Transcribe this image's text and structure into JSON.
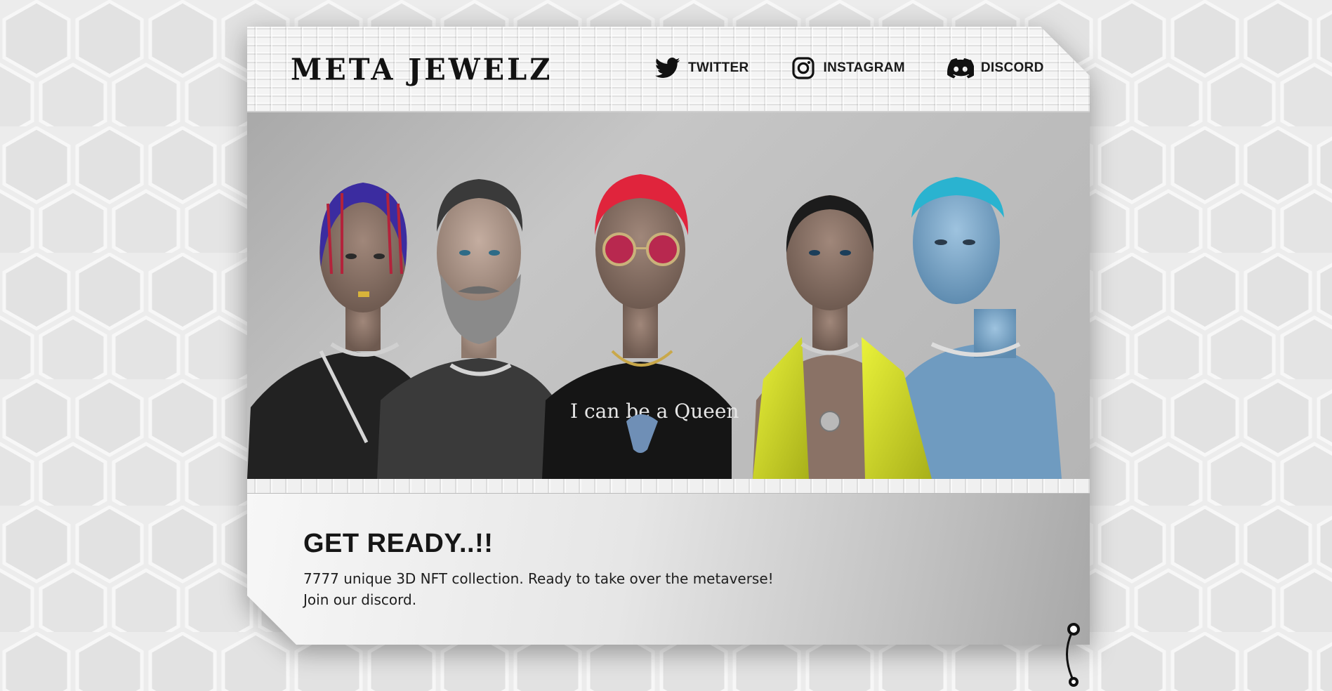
{
  "brand": {
    "logo_text": "META JEWELZ"
  },
  "nav": {
    "items": [
      {
        "label": "TWITTER",
        "icon": "twitter-icon"
      },
      {
        "label": "INSTAGRAM",
        "icon": "instagram-icon"
      },
      {
        "label": "DISCORD",
        "icon": "discord-icon"
      }
    ]
  },
  "hero": {
    "characters": [
      {
        "name": "braided-hair-character",
        "hair_color": "#3b2ca0"
      },
      {
        "name": "bearded-character",
        "hair_color": "#3a3a3a"
      },
      {
        "name": "red-hair-sunglasses-character",
        "hair_color": "#e0243c",
        "shirt_text": "I can be a Queen"
      },
      {
        "name": "yellow-jacket-character",
        "hair_color": "#1c1c1c"
      },
      {
        "name": "blue-character",
        "hair_color": "#2ab3d0"
      }
    ]
  },
  "content": {
    "headline": "GET READY..!!",
    "line1": "7777 unique 3D NFT collection. Ready to take over the metaverse!",
    "line2": "Join our discord."
  },
  "colors": {
    "background": "#ececec",
    "text": "#161616",
    "accent_red": "#e0243c",
    "accent_yellow": "#d7e22a",
    "accent_blue": "#6fa0c8"
  }
}
